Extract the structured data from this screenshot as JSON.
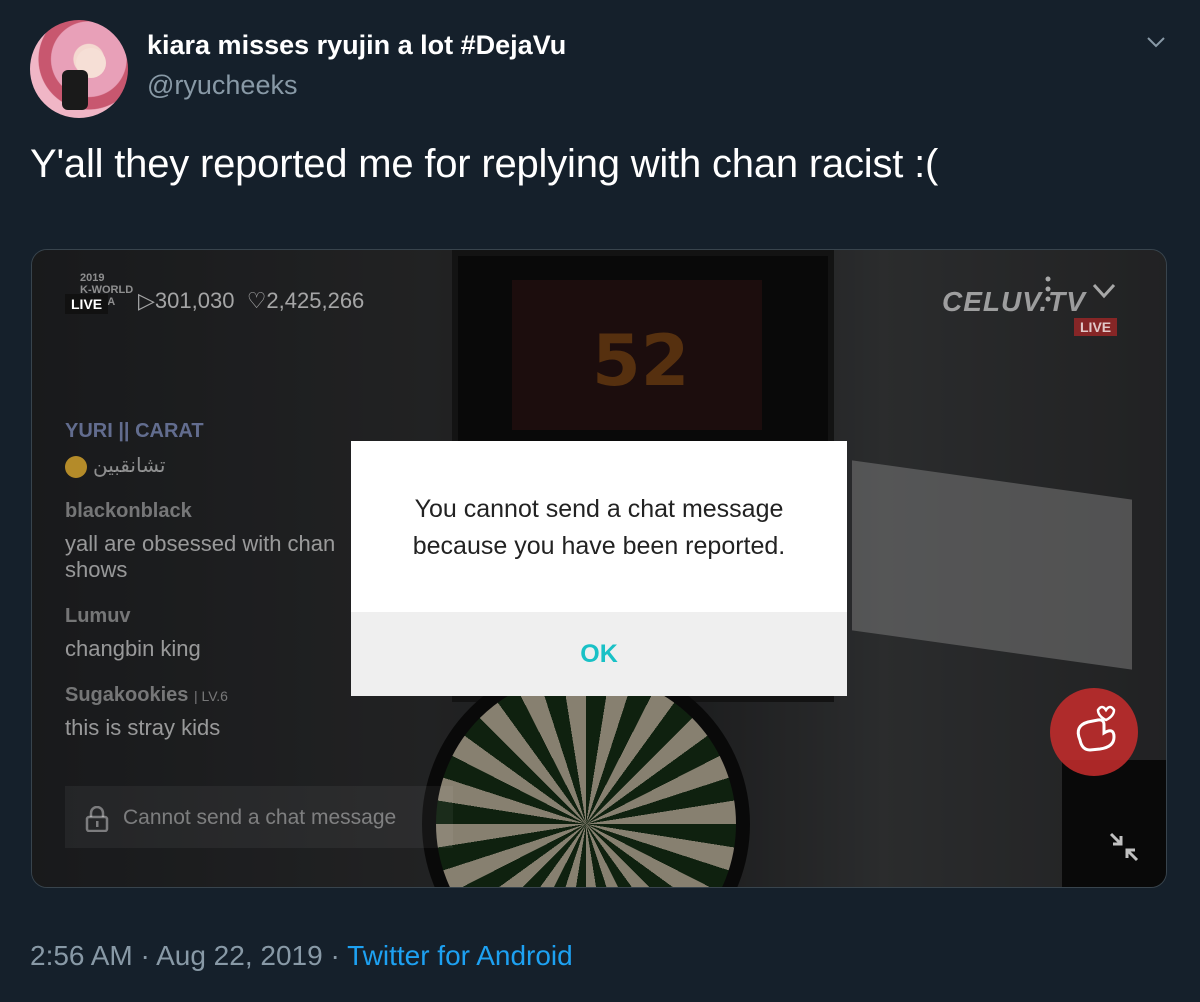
{
  "tweet": {
    "display_name": "kiara misses ryujin a lot #DejaVu",
    "handle": "@ryucheeks",
    "text": "Y'all they reported me for replying with chan racist :(",
    "time": "2:56 AM",
    "date": "Aug 22, 2019",
    "separator": "·",
    "client": "Twitter for Android"
  },
  "media": {
    "live_badge": "LIVE",
    "event_logo": "2019\nK-WORLD\nFESTA",
    "views": "301,030",
    "likes": "2,425,266",
    "channel_logo": "CELUV.TV",
    "channel_live": "LIVE",
    "scoreboard_number": "52",
    "chat": {
      "pinned_user": "YURI || CARAT",
      "pinned_message": "تشانقبين",
      "messages": [
        {
          "user": "blackonblack",
          "level": "",
          "text": "yall are obsessed with chan\nshows"
        },
        {
          "user": "Lumuv",
          "level": "",
          "text": "changbin king"
        },
        {
          "user": "Sugakookies",
          "level": "| LV.6",
          "text": "this is stray kids"
        }
      ],
      "input_placeholder": "Cannot send a chat message"
    },
    "dialog": {
      "message_line1": "You cannot send a chat message",
      "message_line2": "because you have been reported.",
      "ok_label": "OK"
    }
  },
  "colors": {
    "background": "#15202b",
    "secondary_text": "#8899a6",
    "link": "#1da1f2",
    "dialog_ok": "#19c1c6"
  }
}
